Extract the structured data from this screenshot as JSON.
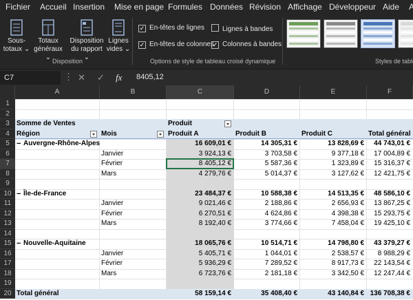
{
  "menu": {
    "tabs": [
      "Fichier",
      "Accueil",
      "Insertion",
      "Mise en page",
      "Formules",
      "Données",
      "Révision",
      "Affichage",
      "Développeur",
      "Aide",
      "A"
    ]
  },
  "ribbon": {
    "layout": {
      "subtotals": [
        "Sous-",
        "totaux"
      ],
      "grandtotals": [
        "Totaux",
        "généraux"
      ],
      "report_layout": [
        "Disposition",
        "du rapport"
      ],
      "blank_rows": [
        "Lignes",
        "vides"
      ],
      "group_label": "Disposition"
    },
    "style_options": {
      "row_headers": "En-têtes de lignes",
      "banded_rows": "Lignes à bandes",
      "col_headers": "En-têtes de colonnes",
      "banded_cols": "Colonnes à bandes",
      "checked": {
        "row_headers": true,
        "banded_rows": false,
        "col_headers": true,
        "banded_cols": true
      },
      "group_label": "Options de style de tableau croisé dynamique"
    },
    "styles": {
      "group_label": "Styles de tablea",
      "swatch_accents": [
        "#6e9e5a",
        "#8a8a8a",
        "#4a76b8",
        "#d9d9d9",
        "#5b87c9"
      ]
    }
  },
  "formula_bar": {
    "name_box": "C7",
    "cancel_icon": "✕",
    "enter_icon": "✓",
    "fx_label": "fx",
    "value": "8405,12"
  },
  "grid": {
    "columns": [
      "A",
      "B",
      "C",
      "D",
      "E",
      "F"
    ],
    "row_numbers": [
      "1",
      "2",
      "3",
      "4",
      "5",
      "6",
      "7",
      "8",
      "9",
      "10",
      "11",
      "12",
      "13",
      "14",
      "15",
      "16",
      "17",
      "18",
      "19",
      "20"
    ],
    "header": {
      "values_label": "Somme de Ventes",
      "col_field": "Produit",
      "row_field": "Région",
      "month_field": "Mois",
      "products": [
        "Produit A",
        "Produit B",
        "Produit C",
        "Total général"
      ]
    },
    "regions": [
      {
        "name": "Auvergne-Rhône-Alpes",
        "totals": [
          "16 609,01 €",
          "14 305,31 €",
          "13 828,69 €",
          "44 743,01 €"
        ],
        "months": [
          {
            "name": "Janvier",
            "values": [
              "3 924,13 €",
              "3 703,58 €",
              "9 377,18 €",
              "17 004,89 €"
            ]
          },
          {
            "name": "Février",
            "values": [
              "8 405,12 €",
              "5 587,36 €",
              "1 323,89 €",
              "15 316,37 €"
            ]
          },
          {
            "name": "Mars",
            "values": [
              "4 279,76 €",
              "5 014,37 €",
              "3 127,62 €",
              "12 421,75 €"
            ]
          }
        ]
      },
      {
        "name": "Île-de-France",
        "totals": [
          "23 484,37 €",
          "10 588,38 €",
          "14 513,35 €",
          "48 586,10 €"
        ],
        "months": [
          {
            "name": "Janvier",
            "values": [
              "9 021,46 €",
              "2 188,86 €",
              "2 656,93 €",
              "13 867,25 €"
            ]
          },
          {
            "name": "Février",
            "values": [
              "6 270,51 €",
              "4 624,86 €",
              "4 398,38 €",
              "15 293,75 €"
            ]
          },
          {
            "name": "Mars",
            "values": [
              "8 192,40 €",
              "3 774,66 €",
              "7 458,04 €",
              "19 425,10 €"
            ]
          }
        ]
      },
      {
        "name": "Nouvelle-Aquitaine",
        "totals": [
          "18 065,76 €",
          "10 514,71 €",
          "14 798,80 €",
          "43 379,27 €"
        ],
        "months": [
          {
            "name": "Janvier",
            "values": [
              "5 405,71 €",
              "1 044,01 €",
              "2 538,57 €",
              "8 988,29 €"
            ]
          },
          {
            "name": "Février",
            "values": [
              "5 936,29 €",
              "7 289,52 €",
              "8 917,73 €",
              "22 143,54 €"
            ]
          },
          {
            "name": "Mars",
            "values": [
              "6 723,76 €",
              "2 181,18 €",
              "3 342,50 €",
              "12 247,44 €"
            ]
          }
        ]
      }
    ],
    "grand_total": {
      "label": "Total général",
      "values": [
        "58 159,14 €",
        "35 408,40 €",
        "43 140,84 €",
        "136 708,38 €"
      ]
    }
  }
}
